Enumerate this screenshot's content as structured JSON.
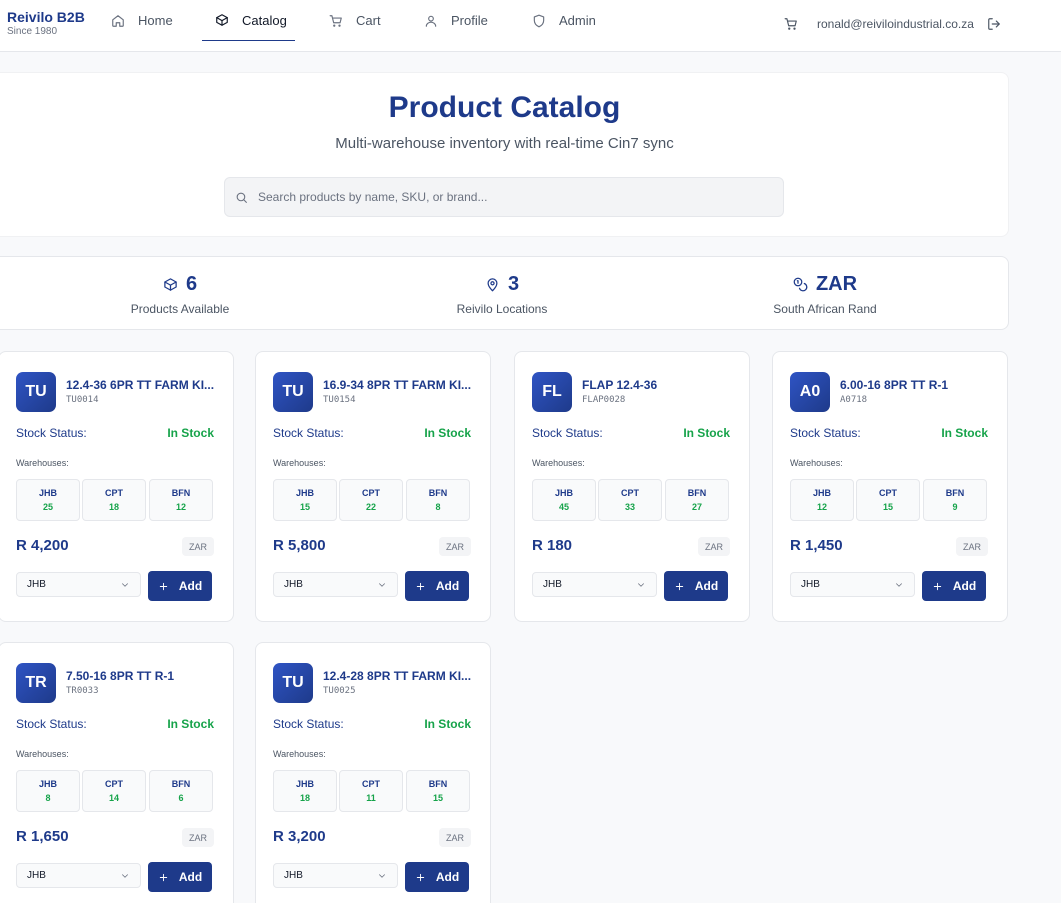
{
  "brand": {
    "name": "Reivilo B2B",
    "tagline": "Since 1980"
  },
  "nav": {
    "items": [
      {
        "label": "Home",
        "icon": "home-icon"
      },
      {
        "label": "Catalog",
        "icon": "box-icon",
        "active": true
      },
      {
        "label": "Cart",
        "icon": "cart-icon"
      },
      {
        "label": "Profile",
        "icon": "user-icon"
      },
      {
        "label": "Admin",
        "icon": "shield-icon"
      }
    ],
    "user_email": "ronald@reiviloindustrial.co.za"
  },
  "hero": {
    "title": "Product Catalog",
    "subtitle": "Multi-warehouse inventory with real-time Cin7 sync",
    "search_placeholder": "Search products by name, SKU, or brand..."
  },
  "stats": [
    {
      "icon": "box-icon",
      "value": "6",
      "label": "Products Available"
    },
    {
      "icon": "map-pin-icon",
      "value": "3",
      "label": "Reivilo Locations"
    },
    {
      "icon": "coins-icon",
      "value": "ZAR",
      "label": "South African Rand"
    }
  ],
  "card_labels": {
    "stock_status": "Stock Status:",
    "warehouses": "Warehouses:",
    "add": "Add"
  },
  "products": [
    {
      "initials": "TU",
      "name": "12.4-36 6PR TT FARM KI...",
      "sku": "TU0014",
      "stock": "In Stock",
      "warehouses": [
        {
          "code": "JHB",
          "qty": "25"
        },
        {
          "code": "CPT",
          "qty": "18"
        },
        {
          "code": "BFN",
          "qty": "12"
        }
      ],
      "price": "R 4,200",
      "currency": "ZAR",
      "selected_warehouse": "JHB"
    },
    {
      "initials": "TU",
      "name": "16.9-34 8PR TT FARM KI...",
      "sku": "TU0154",
      "stock": "In Stock",
      "warehouses": [
        {
          "code": "JHB",
          "qty": "15"
        },
        {
          "code": "CPT",
          "qty": "22"
        },
        {
          "code": "BFN",
          "qty": "8"
        }
      ],
      "price": "R 5,800",
      "currency": "ZAR",
      "selected_warehouse": "JHB"
    },
    {
      "initials": "FL",
      "name": "FLAP 12.4-36",
      "sku": "FLAP0028",
      "stock": "In Stock",
      "warehouses": [
        {
          "code": "JHB",
          "qty": "45"
        },
        {
          "code": "CPT",
          "qty": "33"
        },
        {
          "code": "BFN",
          "qty": "27"
        }
      ],
      "price": "R 180",
      "currency": "ZAR",
      "selected_warehouse": "JHB"
    },
    {
      "initials": "A0",
      "name": "6.00-16 8PR TT R-1",
      "sku": "A0718",
      "stock": "In Stock",
      "warehouses": [
        {
          "code": "JHB",
          "qty": "12"
        },
        {
          "code": "CPT",
          "qty": "15"
        },
        {
          "code": "BFN",
          "qty": "9"
        }
      ],
      "price": "R 1,450",
      "currency": "ZAR",
      "selected_warehouse": "JHB"
    },
    {
      "initials": "TR",
      "name": "7.50-16 8PR TT R-1",
      "sku": "TR0033",
      "stock": "In Stock",
      "warehouses": [
        {
          "code": "JHB",
          "qty": "8"
        },
        {
          "code": "CPT",
          "qty": "14"
        },
        {
          "code": "BFN",
          "qty": "6"
        }
      ],
      "price": "R 1,650",
      "currency": "ZAR",
      "selected_warehouse": "JHB"
    },
    {
      "initials": "TU",
      "name": "12.4-28 8PR TT FARM KI...",
      "sku": "TU0025",
      "stock": "In Stock",
      "warehouses": [
        {
          "code": "JHB",
          "qty": "18"
        },
        {
          "code": "CPT",
          "qty": "11"
        },
        {
          "code": "BFN",
          "qty": "15"
        }
      ],
      "price": "R 3,200",
      "currency": "ZAR",
      "selected_warehouse": "JHB"
    }
  ],
  "colors": {
    "brand": "#1e3a8a",
    "in_stock": "#16a34a",
    "background": "#f8f9fb"
  }
}
